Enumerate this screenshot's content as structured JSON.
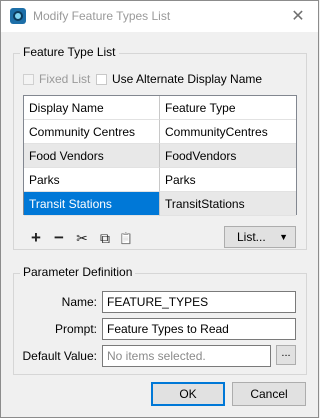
{
  "window": {
    "title": "Modify Feature Types List",
    "close_glyph": "✕"
  },
  "feature_type_list": {
    "legend": "Feature Type List",
    "fixed_list_label": "Fixed List",
    "alternate_name_label": "Use Alternate Display Name",
    "columns": [
      "Display Name",
      "Feature Type"
    ],
    "rows": [
      {
        "display_name": "Community Centres",
        "feature_type": "CommunityCentres"
      },
      {
        "display_name": "Food Vendors",
        "feature_type": "FoodVendors"
      },
      {
        "display_name": "Parks",
        "feature_type": "Parks"
      },
      {
        "display_name": "Transit Stations",
        "feature_type": "TransitStations"
      }
    ],
    "selected_row": 3,
    "toolbar": {
      "add_glyph": "+",
      "remove_glyph": "−",
      "cut_glyph": "✂",
      "copy_glyph": "⧉",
      "paste_glyph": "📋"
    },
    "list_button_label": "List...",
    "list_button_arrow": "▼"
  },
  "parameter_definition": {
    "legend": "Parameter Definition",
    "name_label": "Name:",
    "name_value": "FEATURE_TYPES",
    "prompt_label": "Prompt:",
    "prompt_value": "Feature Types to Read",
    "default_label": "Default Value:",
    "default_placeholder": "No items selected.",
    "browse_label": "..."
  },
  "buttons": {
    "ok": "OK",
    "cancel": "Cancel"
  },
  "colors": {
    "accent": "#0078d7",
    "selected_text": "#ffffff",
    "alt_row": "#e8e8e8"
  }
}
